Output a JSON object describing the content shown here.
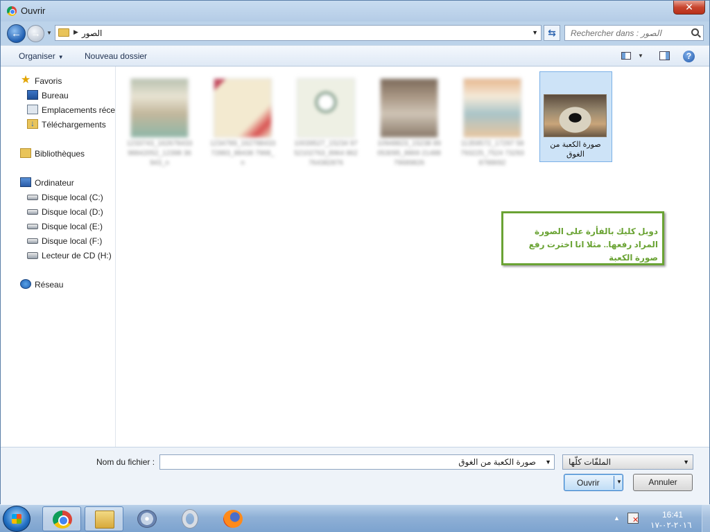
{
  "window": {
    "title": "Ouvrir",
    "close_symbol": "✕"
  },
  "nav": {
    "back_symbol": "←",
    "forward_symbol": "→",
    "address_path": "الصور",
    "refresh_symbol": "⇆",
    "search_placeholder": "Rechercher dans : الصور"
  },
  "toolbar": {
    "organise_label": "Organiser",
    "new_folder_label": "Nouveau dossier",
    "help_label": "?"
  },
  "sidebar": {
    "favorites": "Favoris",
    "desktop": "Bureau",
    "recent": "Emplacements récents",
    "downloads": "Téléchargements",
    "libraries": "Bibliothèques",
    "computer": "Ordinateur",
    "drive_c": "Disque local (C:)",
    "drive_d": "Disque local (D:)",
    "drive_e": "Disque local (E:)",
    "drive_f": "Disque local (F:)",
    "drive_h": "Lecteur de CD (H:)",
    "network": "Réseau"
  },
  "files": {
    "f1": "1233743_16267843398842052_12398 36943_n",
    "f2": "1234789_16278843372883_88438 7968_n",
    "f3": "10039527_15234 9752102763_8964 862764382876",
    "f4": "10948823_15238 89053095_8869 2148879689826",
    "f5": "11359572_17297 58793225_7524 732938788692",
    "selected": "صورة الكعبة من الغوق"
  },
  "tooltip": {
    "text": "دوبل كليك بالفأرة على الصورة المراد رفعها.. مثلا انا اخترت رفع صورة الكعبة"
  },
  "bottom": {
    "filename_label": "Nom du fichier :",
    "filename_value": "صورة الكعبة من الغوق",
    "filter_value": "الملفّات كلّها",
    "open_label": "Ouvrir",
    "cancel_label": "Annuler"
  },
  "taskbar": {
    "apps": [
      "chrome-icon",
      "explorer-icon",
      "dvd-maker-icon",
      "opera-icon",
      "firefox-icon"
    ],
    "time": "16:41",
    "date": "٢٠١٦-٠٢-١٧"
  }
}
